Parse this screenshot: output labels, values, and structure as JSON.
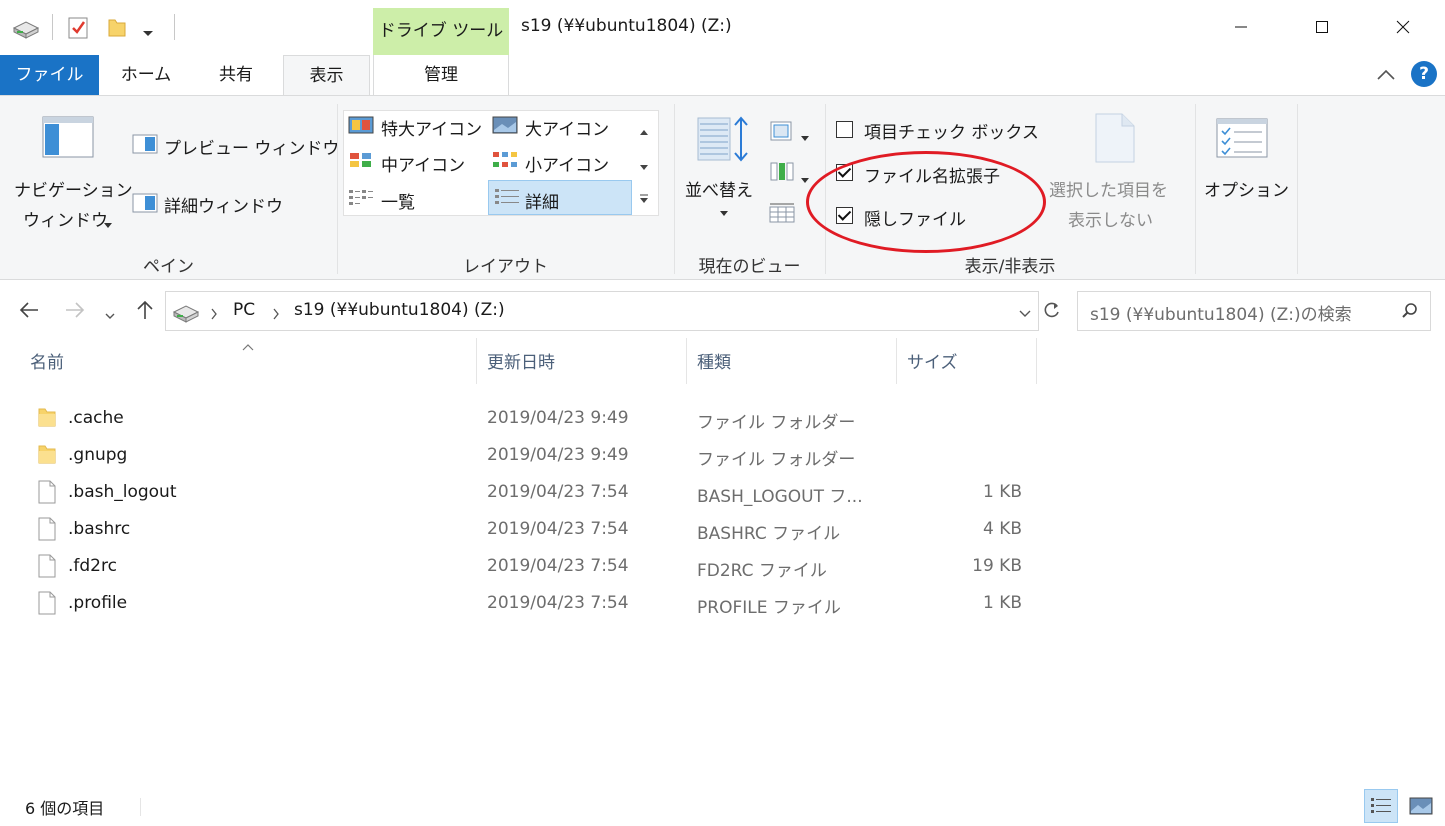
{
  "window": {
    "title": "s19 (¥¥ubuntu1804) (Z:)",
    "context_tab": "ドライブ ツール"
  },
  "tabs": {
    "file": "ファイル",
    "home": "ホーム",
    "share": "共有",
    "view": "表示",
    "manage": "管理"
  },
  "ribbon": {
    "pane": {
      "nav_pane_line1": "ナビゲーション",
      "nav_pane_line2": "ウィンドウ",
      "preview_pane": "プレビュー ウィンドウ",
      "details_pane": "詳細ウィンドウ",
      "label": "ペイン"
    },
    "layout": {
      "extra_large_icons": "特大アイコン",
      "large_icons": "大アイコン",
      "medium_icons": "中アイコン",
      "small_icons": "小アイコン",
      "list": "一覧",
      "details": "詳細",
      "label": "レイアウト"
    },
    "current_view": {
      "sort_by": "並べ替え",
      "label": "現在のビュー"
    },
    "show_hide": {
      "item_check_boxes": "項目チェック ボックス",
      "item_check_boxes_checked": false,
      "file_name_extensions": "ファイル名拡張子",
      "file_name_extensions_checked": true,
      "hidden_items": "隠しファイル",
      "hidden_items_checked": true,
      "hide_selected_line1": "選択した項目を",
      "hide_selected_line2": "表示しない",
      "label": "表示/非表示"
    },
    "options": {
      "label": "オプション"
    }
  },
  "address": {
    "crumb_pc": "PC",
    "crumb_drive": "s19 (¥¥ubuntu1804) (Z:)",
    "search_placeholder": "s19 (¥¥ubuntu1804) (Z:)の検索"
  },
  "columns": {
    "name": "名前",
    "date": "更新日時",
    "type": "種類",
    "size": "サイズ"
  },
  "files": [
    {
      "name": ".cache",
      "date": "2019/04/23 9:49",
      "type": "ファイル フォルダー",
      "size": "",
      "kind": "folder"
    },
    {
      "name": ".gnupg",
      "date": "2019/04/23 9:49",
      "type": "ファイル フォルダー",
      "size": "",
      "kind": "folder"
    },
    {
      "name": ".bash_logout",
      "date": "2019/04/23 7:54",
      "type": "BASH_LOGOUT フ...",
      "size": "1 KB",
      "kind": "file"
    },
    {
      "name": ".bashrc",
      "date": "2019/04/23 7:54",
      "type": "BASHRC ファイル",
      "size": "4 KB",
      "kind": "file"
    },
    {
      "name": ".fd2rc",
      "date": "2019/04/23 7:54",
      "type": "FD2RC ファイル",
      "size": "19 KB",
      "kind": "file"
    },
    {
      "name": ".profile",
      "date": "2019/04/23 7:54",
      "type": "PROFILE ファイル",
      "size": "1 KB",
      "kind": "file"
    }
  ],
  "status": {
    "item_count": "6 個の項目"
  },
  "colors": {
    "file_tab": "#1a73c6",
    "context_tab": "#cdeea9",
    "annotation_circle": "#e01b24",
    "selection": "#cce4f7",
    "help_button": "#1a73c6"
  }
}
